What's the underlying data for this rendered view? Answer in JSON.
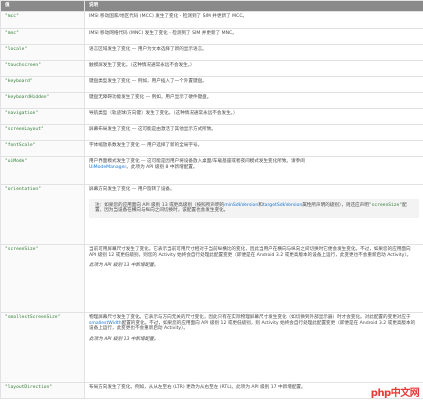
{
  "table": {
    "headers": [
      "值",
      "说明"
    ],
    "rows": [
      {
        "value": "\"mcc\"",
        "desc": "IMSI 移动国家/地区代码 (MCC) 发生了变化 - 检测到了 SIM 并更新了 MCC。"
      },
      {
        "value": "\"mnc\"",
        "desc": "IMSI 移动网络代码 (MNC) 发生了变化 - 检测到了 SIM 并更新了 MNC。"
      },
      {
        "value": "\"locale\"",
        "desc": "语言区域发生了变化 — 用户为文本选择了新的显示语言。"
      },
      {
        "value": "\"touchscreen\"",
        "desc": "触摸屏发生了变化。（这种情况通常永远不会发生。）"
      },
      {
        "value": "\"keyboard\"",
        "desc": "键盘类型发生了变化 — 例如，用户插入了一个外置键盘。"
      },
      {
        "value": "\"keyboardHidden\"",
        "desc": "键盘无障碍功能发生了变化 — 例如，用户显示了硬件键盘。"
      },
      {
        "value": "\"navigation\"",
        "desc": "导航类型（轨迹球/方向键）发生了变化。（这种情况通常永远不会发生。）"
      },
      {
        "value": "\"screenLayout\"",
        "desc": "屏幕布局发生了变化 — 这可能是由激活了其他显示方式所致。"
      },
      {
        "value": "\"fontScale\"",
        "desc": "字体缩放系数发生了变化 — 用户选择了新的全局字号。"
      },
      {
        "value": "\"uiMode\"",
        "desc": "用户界面模式发生了变化 — 这可能是因用户将设备放入桌面/车载基座或者夜间模式发生变化所致。请参阅",
        "desc_link": "UiModeManager",
        "desc_tail": "。此项为 API 级别 8 中新增配置。"
      },
      {
        "value": "\"orientation\"",
        "desc": "屏幕方向发生了变化 — 用户旋转了设备。",
        "note_prefix": "注：如果您的应用面向 API 级别 13 或更高级别（按照所声明的",
        "note_code1": "minSdkVersion",
        "note_mid": "和",
        "note_code2": "targetSdkVersion",
        "note_mid2": "属性所声明的级别），则还应声明",
        "note_code3": "\"screenSize\"",
        "note_tail": "配置，因为当设备在横向与纵向之间切换时，该配置也会发生变化。"
      },
      {
        "value": "\"screenSize\"",
        "desc": "当前可用屏幕尺寸发生了变化。它表示当前可用尺寸相对于当前纵横比的变化，因此当用户在横向与纵向之间切换时它便会发生变化。不过，如果您的应用面向 API 级别 12 或更低级别，则您的 Activity 始终会自行处理此配置变更（即便是在 Android 3.2 或更高版本的设备上运行，此变更也不会重新启动 Activity）。",
        "desc2": "此项为 API 级别 13 中新增配置。"
      },
      {
        "value": "\"smallestScreenSize\"",
        "desc": "物理屏幕尺寸发生了变化。它表示与方向无关的尺寸变化，因此只有在实际物理屏幕尺寸发生变化（如切换到外部显示器）时才会变化。对此配置的变更对应于",
        "desc_link": "smallestWidth",
        "desc_tail": "配置的变化。不过，如果您的应用面向 API 级别 12 或更低级别，则 Activity 始终会自行处理此配置变更（即便是在 Android 3.2 或更高版本的设备上运行，此变更也不会重新启动 Activity）。",
        "desc2": "此项为 API 级别 13 中新增配置。"
      },
      {
        "value": "\"layoutDirection\"",
        "desc": "布局方向发生了变化。例如，从从左至右 (LTR) 更改为从右至左 (RTL)。此项为 API 级别 17 中新增配置。"
      }
    ]
  },
  "watermark": {
    "text": "php中文网"
  }
}
